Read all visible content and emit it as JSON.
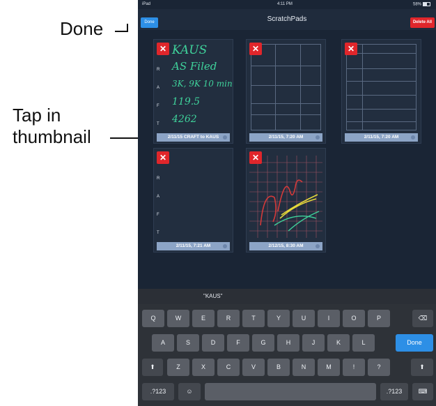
{
  "callouts": {
    "done": "Done",
    "tap_line1": "Tap in",
    "tap_line2": "thumbnail"
  },
  "status": {
    "device": "iPad",
    "time": "4:11 PM",
    "battery": "58%"
  },
  "nav": {
    "title": "ScratchPads",
    "done": "Done",
    "delete_all": "Delete All"
  },
  "thumbnails": [
    {
      "caption": "2/11/15 CRAFT to KAUS",
      "lines": [
        "KAUS",
        "AS Filed",
        "3K, 9K 10 min",
        "119.5",
        "4262"
      ]
    },
    {
      "caption": "2/11/15, 7:20 AM"
    },
    {
      "caption": "2/11/15, 7:20 AM"
    },
    {
      "caption": "2/11/15, 7:21 AM"
    },
    {
      "caption": "2/12/15, 8:30 AM"
    }
  ],
  "rafte": [
    "R",
    "A",
    "F",
    "T"
  ],
  "keyboard": {
    "suggestion": "\"KAUS\"",
    "row1": [
      "Q",
      "W",
      "E",
      "R",
      "T",
      "Y",
      "U",
      "I",
      "O",
      "P"
    ],
    "row2": [
      "A",
      "S",
      "D",
      "F",
      "G",
      "H",
      "J",
      "K",
      "L"
    ],
    "row3": [
      "Z",
      "X",
      "C",
      "V",
      "B",
      "N",
      "M",
      "!",
      "?"
    ],
    "done": "Done",
    "num": ".?123"
  },
  "colors": {
    "accent": "#2d8fe6",
    "danger": "#e0262b",
    "ink": "#3fd29b"
  }
}
